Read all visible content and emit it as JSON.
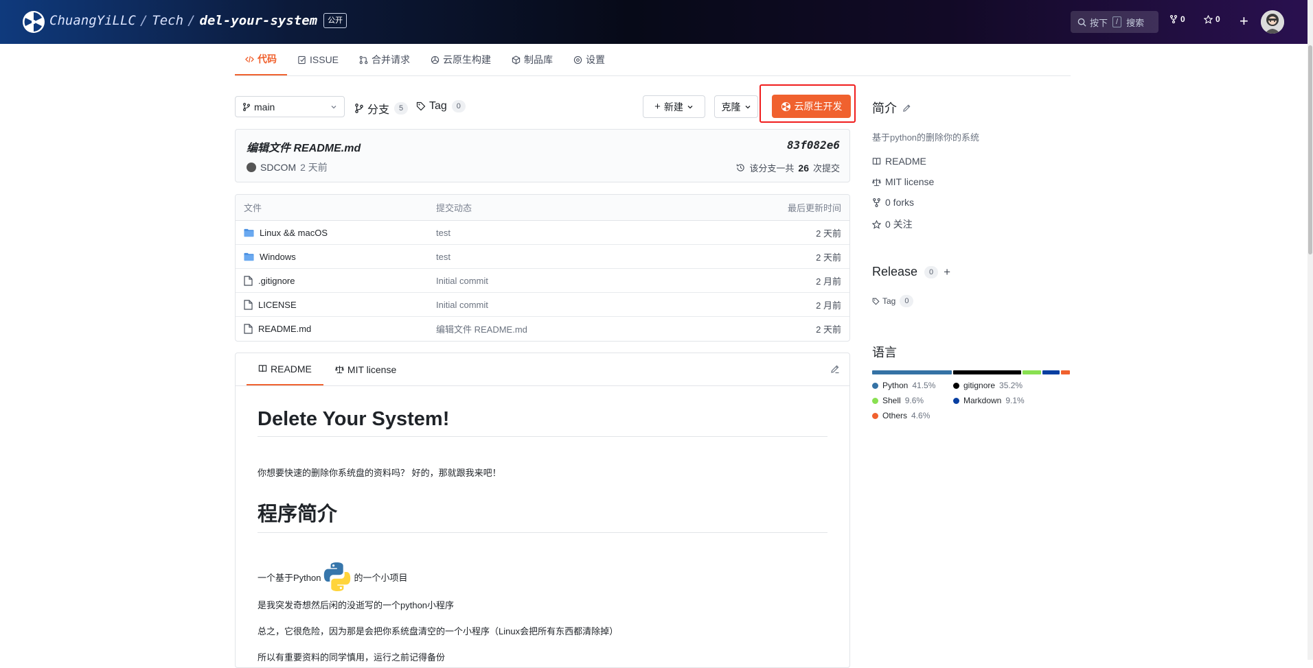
{
  "header": {
    "owner": "ChuangYiLLC",
    "group": "Tech",
    "repo": "del-your-system",
    "visibility_badge": "公开",
    "search_prefix": "按下",
    "search_key": "/",
    "search_suffix": "搜索",
    "forks_count": "0",
    "stars_count": "0",
    "plus_glyph": "+"
  },
  "tabs": [
    {
      "label": "代码",
      "icon": "code-icon",
      "active": true
    },
    {
      "label": "ISSUE",
      "icon": "issue-icon"
    },
    {
      "label": "合并请求",
      "icon": "merge-request-icon"
    },
    {
      "label": "云原生构建",
      "icon": "cloud-build-icon"
    },
    {
      "label": "制品库",
      "icon": "package-icon"
    },
    {
      "label": "设置",
      "icon": "settings-icon"
    }
  ],
  "toolbar": {
    "branch": "main",
    "branches_label": "分支",
    "branches_count": "5",
    "tags_label": "Tag",
    "tags_count": "0",
    "new_label": "新建",
    "clone_label": "克隆",
    "cloud_dev_label": "云原生开发"
  },
  "commit": {
    "title": "编辑文件 README.md",
    "hash": "83f082e6",
    "author": "SDCOM",
    "time": "2 天前",
    "count_prefix": "该分支一共",
    "count": "26",
    "count_suffix": "次提交"
  },
  "files": {
    "headers": {
      "name": "文件",
      "message": "提交动态",
      "time": "最后更新时间"
    },
    "rows": [
      {
        "name": "Linux && macOS",
        "type": "folder",
        "message": "test",
        "time": "2 天前"
      },
      {
        "name": "Windows",
        "type": "folder",
        "message": "test",
        "time": "2 天前"
      },
      {
        "name": ".gitignore",
        "type": "file",
        "message": "Initial commit",
        "time": "2 月前"
      },
      {
        "name": "LICENSE",
        "type": "file",
        "message": "Initial commit",
        "time": "2 月前"
      },
      {
        "name": "README.md",
        "type": "file",
        "message": "编辑文件 README.md",
        "time": "2 天前"
      }
    ]
  },
  "readme": {
    "tab_readme": "README",
    "tab_license": "MIT license",
    "h1": "Delete Your System!",
    "p1": "你想要快速的删除你系统盘的资料吗？ 好的，那就跟我来吧！",
    "h2": "程序简介",
    "p2_before": "一个基于Python",
    "p2_after": "的一个小项目",
    "p3": "是我突发奇想然后闲的没逝写的一个python小程序",
    "p4": "总之，它很危险，因为那是会把你系统盘清空的一个小程序（Linux会把所有东西都清除掉）",
    "p5": "所以有重要资料的同学慎用，运行之前记得备份"
  },
  "sidebar": {
    "intro_title": "简介",
    "description": "基于python的删除你的系统",
    "links": [
      {
        "label": "README",
        "icon": "book-icon"
      },
      {
        "label": "MIT license",
        "icon": "scale-icon"
      },
      {
        "label": "0 forks",
        "icon": "fork-icon"
      },
      {
        "label": "0 关注",
        "icon": "star-icon"
      }
    ],
    "release_title": "Release",
    "release_count": "0",
    "release_add": "+",
    "tag_label": "Tag",
    "tag_count": "0",
    "lang_title": "语言",
    "languages": [
      {
        "name": "Python",
        "pct": "41.5%",
        "value": 41.5,
        "color": "#3572A5"
      },
      {
        "name": "gitignore",
        "pct": "35.2%",
        "value": 35.2,
        "color": "#000000"
      },
      {
        "name": "Shell",
        "pct": "9.6%",
        "value": 9.6,
        "color": "#89e051"
      },
      {
        "name": "Markdown",
        "pct": "9.1%",
        "value": 9.1,
        "color": "#083fa1"
      },
      {
        "name": "Others",
        "pct": "4.6%",
        "value": 4.6,
        "color": "#f0612e"
      }
    ]
  },
  "colors": {
    "accent": "#f0612e",
    "highlight_border": "#f01c1c"
  }
}
